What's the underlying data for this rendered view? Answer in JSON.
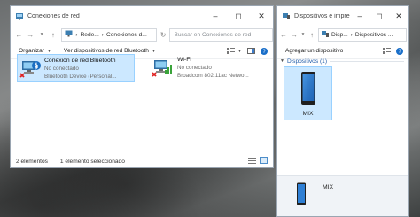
{
  "colors": {
    "accent": "#0078d7",
    "selection": "#cce8ff",
    "group_header": "#1e5aa8"
  },
  "left_window": {
    "title": "Conexiones de red",
    "breadcrumb": [
      "Rede...",
      "Conexiones d..."
    ],
    "search_placeholder": "Buscar en Conexiones de red",
    "commands": {
      "organize": "Organizar",
      "view_bluetooth": "Ver dispositivos de red Bluetooth"
    },
    "items": [
      {
        "name": "Conexión de red Bluetooth",
        "status": "No conectado",
        "device": "Bluetooth Device (Personal...",
        "icon": "bluetooth-network-icon",
        "selected": true
      },
      {
        "name": "Wi-Fi",
        "status": "No conectado",
        "device": "Broadcom 802.11ac Netwo...",
        "icon": "wifi-network-icon",
        "selected": false
      }
    ],
    "status": {
      "count": "2 elementos",
      "selected": "1 elemento seleccionado"
    }
  },
  "right_window": {
    "title": "Dispositivos e impre...",
    "breadcrumb": [
      "Disp...",
      "Dispositivos ..."
    ],
    "commands": {
      "add_device": "Agregar un dispositivo"
    },
    "group_header": "Dispositivos (1)",
    "device": {
      "name": "MIX",
      "icon": "phone-icon"
    },
    "details": {
      "name": "MIX"
    }
  }
}
